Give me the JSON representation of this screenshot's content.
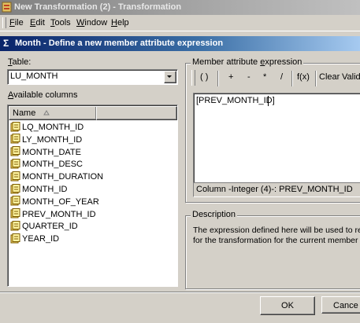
{
  "window": {
    "title": "New Transformation (2) - Transformation"
  },
  "menu": {
    "items": [
      "File",
      "Edit",
      "Tools",
      "Window",
      "Help"
    ]
  },
  "dialog": {
    "title": "Month - Define a new member attribute expression"
  },
  "table": {
    "label": "Table:",
    "selected": "LU_MONTH"
  },
  "columns": {
    "label": "Available columns",
    "header": "Name",
    "items": [
      "LQ_MONTH_ID",
      "LY_MONTH_ID",
      "MONTH_DATE",
      "MONTH_DESC",
      "MONTH_DURATION",
      "MONTH_ID",
      "MONTH_OF_YEAR",
      "PREV_MONTH_ID",
      "QUARTER_ID",
      "YEAR_ID"
    ]
  },
  "expression": {
    "group_label": "Member attribute expression",
    "toolbar": [
      "( )",
      "+",
      "-",
      "*",
      "/",
      "f(x)",
      "Clear",
      "Valida"
    ],
    "value": "[PREV_MONTH_ID]",
    "status": "Column -Integer (4)-: PREV_MONTH_ID"
  },
  "description": {
    "label": "Description",
    "line1": "The expression defined here will be used to retri",
    "line2": "for the transformation for the current member attri"
  },
  "buttons": {
    "ok": "OK",
    "cancel": "Cance"
  }
}
